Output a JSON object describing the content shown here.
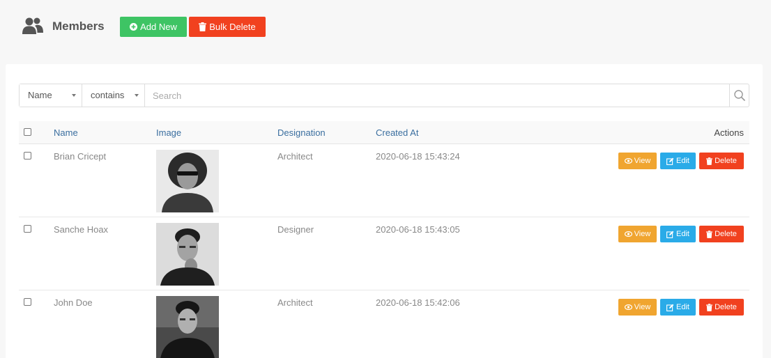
{
  "header": {
    "title": "Members",
    "add_label": "Add New",
    "bulk_label": "Bulk Delete"
  },
  "search": {
    "field": "Name",
    "operator": "contains",
    "placeholder": "Search"
  },
  "table": {
    "columns": {
      "name": "Name",
      "image": "Image",
      "designation": "Designation",
      "created_at": "Created At",
      "actions": "Actions"
    },
    "action_labels": {
      "view": "View",
      "edit": "Edit",
      "delete": "Delete"
    },
    "rows": [
      {
        "name": "Brian Cricept",
        "designation": "Architect",
        "created_at": "2020-06-18 15:43:24"
      },
      {
        "name": "Sanche Hoax",
        "designation": "Designer",
        "created_at": "2020-06-18 15:43:05"
      },
      {
        "name": "John Doe",
        "designation": "Architect",
        "created_at": "2020-06-18 15:42:06"
      }
    ]
  },
  "colors": {
    "add": "#3ec464",
    "bulk_delete": "#f1411f",
    "view": "#f0a530",
    "edit": "#2aabe8",
    "delete": "#f1411f",
    "header_link": "#3a6e9f"
  },
  "icons": {
    "title": "users-icon",
    "add": "plus-circle-icon",
    "bulk": "trash-icon",
    "search": "search-icon",
    "view": "eye-icon",
    "edit": "edit-icon",
    "delete": "trash-icon"
  }
}
